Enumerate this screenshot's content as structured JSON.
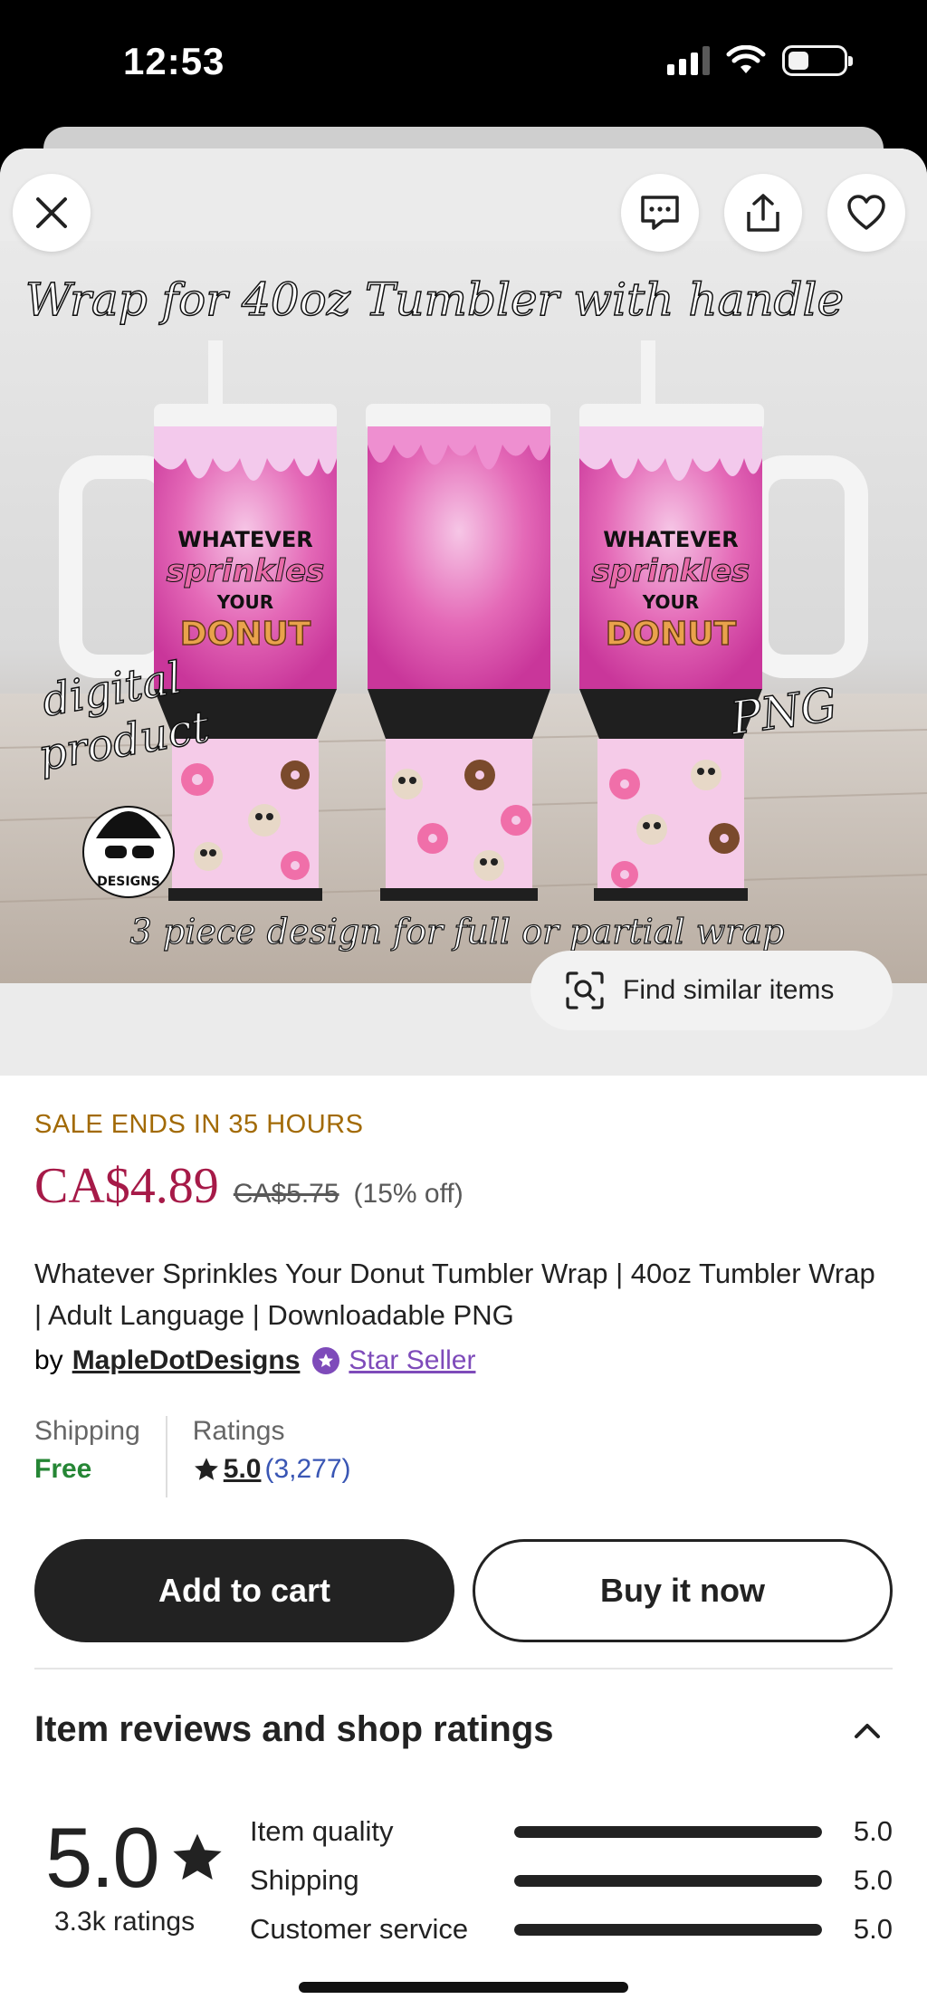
{
  "status_bar": {
    "time": "12:53"
  },
  "hero": {
    "find_similar_label": "Find similar items",
    "image_text": {
      "headline": "Wrap for 40oz Tumbler with handle",
      "left_label_1": "digital",
      "left_label_2": "product",
      "right_label": "PNG",
      "bottom_label": "3 piece design for full or partial wrap",
      "cup_line_1": "WHATEVER",
      "cup_line_2": "sprinkles",
      "cup_line_3": "YOUR",
      "cup_line_4": "DONUT",
      "logo_text": "DESIGNS"
    }
  },
  "product": {
    "sale_banner": "SALE ENDS IN 35 HOURS",
    "price": "CA$4.89",
    "original_price": "CA$5.75",
    "discount": "(15% off)",
    "title": "Whatever Sprinkles Your Donut Tumbler Wrap | 40oz Tumbler Wrap | Adult Language | Downloadable PNG",
    "by_label": "by",
    "seller": "MapleDotDesigns",
    "star_seller_label": "Star Seller",
    "shipping_label": "Shipping",
    "shipping_value": "Free",
    "ratings_label": "Ratings",
    "rating_value": "5.0",
    "rating_count": "(3,277)"
  },
  "actions": {
    "add_to_cart": "Add to cart",
    "buy_now": "Buy it now"
  },
  "reviews": {
    "heading": "Item reviews and shop ratings",
    "overall": "5.0",
    "total_label": "3.3k ratings",
    "breakdown": [
      {
        "label": "Item quality",
        "value": "5.0",
        "fraction": 1.0
      },
      {
        "label": "Shipping",
        "value": "5.0",
        "fraction": 1.0
      },
      {
        "label": "Customer service",
        "value": "5.0",
        "fraction": 1.0
      }
    ]
  },
  "colors": {
    "price": "#a61a48",
    "sale": "#a26a05",
    "free": "#258635",
    "star_seller": "#7e4bba",
    "rating_count": "#3956b4"
  }
}
